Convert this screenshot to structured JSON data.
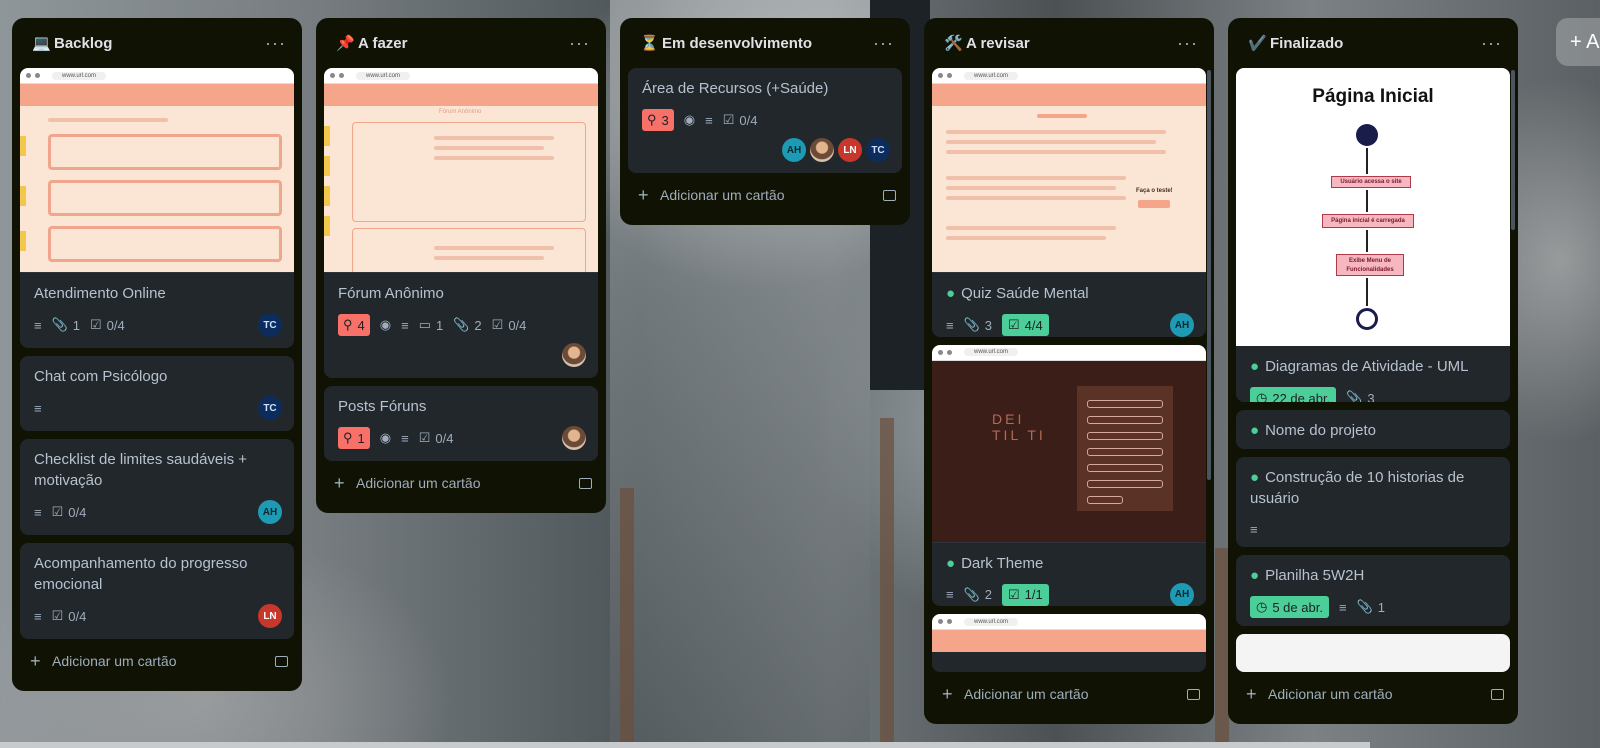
{
  "columns": [
    {
      "emoji": "💻",
      "title": "Backlog",
      "more": "···",
      "add_label": "Adicionar um cartão",
      "cards": [
        {
          "title": "Atendimento Online",
          "cover": "peach-list",
          "url": "www.url.com",
          "attachments": "1",
          "checklist": "0/4",
          "members": [
            "TC"
          ]
        },
        {
          "title": "Chat com Psicólogo",
          "members": [
            "TC"
          ]
        },
        {
          "title": "Checklist de limites saudáveis + motivação",
          "checklist": "0/4",
          "members": [
            "AH"
          ]
        },
        {
          "title": "Acompanhamento do progresso emocional",
          "checklist": "0/4",
          "members": [
            "LN"
          ]
        }
      ]
    },
    {
      "emoji": "📌",
      "title": "A fazer",
      "more": "···",
      "add_label": "Adicionar um cartão",
      "cards": [
        {
          "title": "Fórum Anônimo",
          "cover": "peach-forum",
          "url": "www.url.com",
          "cover_heading": "Fórum Anônimo",
          "votes": "4",
          "comments": "1",
          "attachments": "2",
          "checklist": "0/4"
        },
        {
          "title": "Posts Fóruns",
          "votes": "1",
          "checklist": "0/4"
        }
      ]
    },
    {
      "emoji": "⏳",
      "title": "Em desenvolvimento",
      "more": "···",
      "add_label": "Adicionar um cartão",
      "cards": [
        {
          "title": "Área de Recursos (+Saúde)",
          "votes": "3",
          "checklist": "0/4",
          "members": [
            "AH",
            "LN",
            "TC"
          ]
        }
      ]
    },
    {
      "emoji": "🛠️",
      "title": "A revisar",
      "more": "···",
      "add_label": "Adicionar um cartão",
      "cards": [
        {
          "title": "Quiz Saúde Mental",
          "cover": "peach-quiz",
          "url": "www.url.com",
          "cover_cta": "Faça o teste!",
          "attachments": "3",
          "checklist": "4/4",
          "members": [
            "AH"
          ]
        },
        {
          "title": "Dark Theme",
          "cover": "dark",
          "url": "www.url.com",
          "cover_logo": "DEI TIL TI",
          "attachments": "2",
          "checklist": "1/1",
          "members": [
            "AH"
          ]
        },
        {
          "title": "",
          "cover": "peach-partial",
          "url": "www.url.com"
        }
      ]
    },
    {
      "emoji": "✔️",
      "title": "Finalizado",
      "more": "···",
      "add_label": "Adicionar um cartão",
      "cards": [
        {
          "title": "Diagramas de Atividade - UML",
          "cover": "diagram",
          "diagram_title": "Página Inicial",
          "diagram_steps": [
            "Usuário acessa o site",
            "Página inicial é carregada",
            "Exibe Menu de Funcionalidades"
          ],
          "due": "22 de abr.",
          "attachments": "3"
        },
        {
          "title": "Nome do projeto"
        },
        {
          "title": "Construção de 10 historias de usuário"
        },
        {
          "title": "Planilha 5W2H",
          "due": "5 de abr.",
          "attachments": "1"
        }
      ]
    }
  ],
  "add_list_peek": "+ A"
}
